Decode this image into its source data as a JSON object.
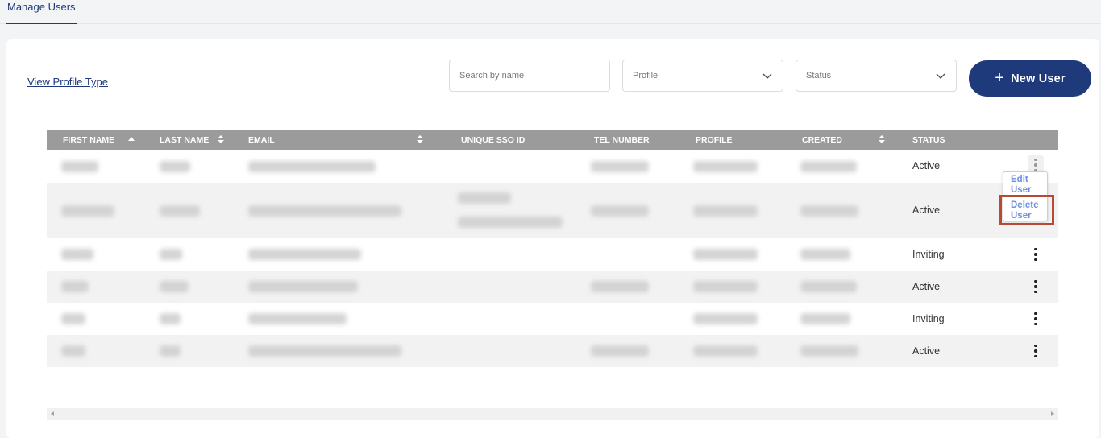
{
  "nav": {
    "active_tab": "Manage Users"
  },
  "toolbar": {
    "view_profile_link": "View Profile Type",
    "search_placeholder": "Search by name",
    "profile_select": "Profile",
    "status_select": "Status",
    "new_user_label": "New User",
    "new_user_icon": "plus-icon"
  },
  "table": {
    "columns": [
      "FIRST NAME",
      "LAST NAME",
      "EMAIL",
      "UNIQUE SSO ID",
      "TEL NUMBER",
      "PROFILE",
      "CREATED",
      "STATUS"
    ],
    "sorted_column": "FIRST NAME",
    "rows": [
      {
        "status": "Active"
      },
      {
        "status": "Active"
      },
      {
        "status": "Inviting"
      },
      {
        "status": "Active"
      },
      {
        "status": "Inviting"
      },
      {
        "status": "Active"
      }
    ]
  },
  "row_menu": {
    "items": [
      "Edit User",
      "Delete User"
    ],
    "edit_line1": "Edit",
    "edit_line2": "User",
    "delete_line1": "Delete",
    "delete_line2": "User",
    "highlighted_item": "Delete User",
    "highlight_color": "#b84a35"
  },
  "colors": {
    "brand": "#1e3a7b",
    "header_bg": "#9b9b9b",
    "menu_text": "#6b8fe0"
  }
}
